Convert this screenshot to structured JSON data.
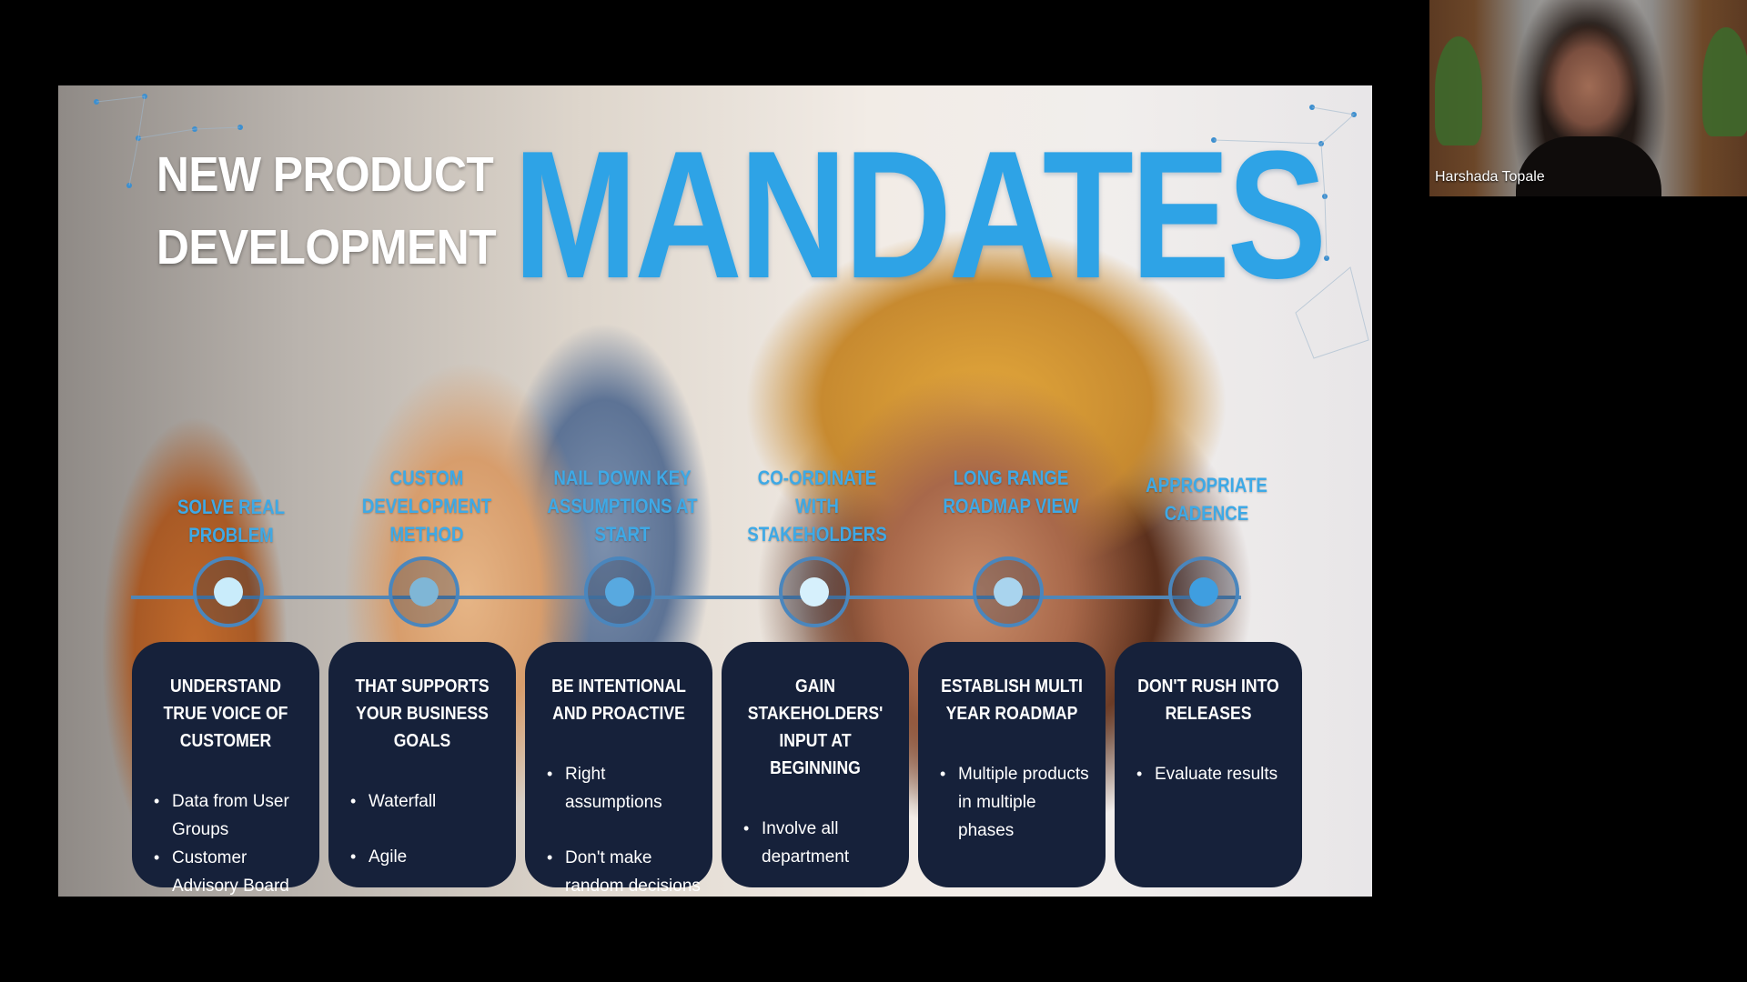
{
  "slide": {
    "title_line1": "NEW PRODUCT",
    "title_line2": "DEVELOPMENT",
    "title_big": "MANDATES",
    "steps": [
      {
        "label": "SOLVE REAL PROBLEM",
        "card_title": "UNDERSTAND TRUE VOICE OF CUSTOMER",
        "bullets": [
          "Data from User Groups",
          "Customer Advisory Board"
        ]
      },
      {
        "label": "CUSTOM DEVELOPMENT METHOD",
        "card_title": "THAT SUPPORTS YOUR BUSINESS GOALS",
        "bullets": [
          "Waterfall",
          "Agile"
        ]
      },
      {
        "label": "NAIL DOWN KEY ASSUMPTIONS AT START",
        "card_title": "BE INTENTIONAL AND PROACTIVE",
        "bullets": [
          "Right assumptions",
          "Don't make random decisions"
        ]
      },
      {
        "label": "CO-ORDINATE WITH STAKEHOLDERS",
        "card_title": "GAIN STAKEHOLDERS' INPUT AT BEGINNING",
        "bullets": [
          "Involve all department"
        ]
      },
      {
        "label": "LONG RANGE ROADMAP VIEW",
        "card_title": "ESTABLISH MULTI YEAR ROADMAP",
        "bullets": [
          "Multiple products in multiple phases"
        ]
      },
      {
        "label": "APPROPRIATE CADENCE",
        "card_title": "DON'T RUSH INTO RELEASES",
        "bullets": [
          "Evaluate results"
        ]
      }
    ]
  },
  "participant": {
    "name": "Harshada Topale"
  },
  "colors": {
    "accent": "#2ea3e6",
    "card_bg": "#16213a",
    "timeline": "#4f86b8"
  }
}
